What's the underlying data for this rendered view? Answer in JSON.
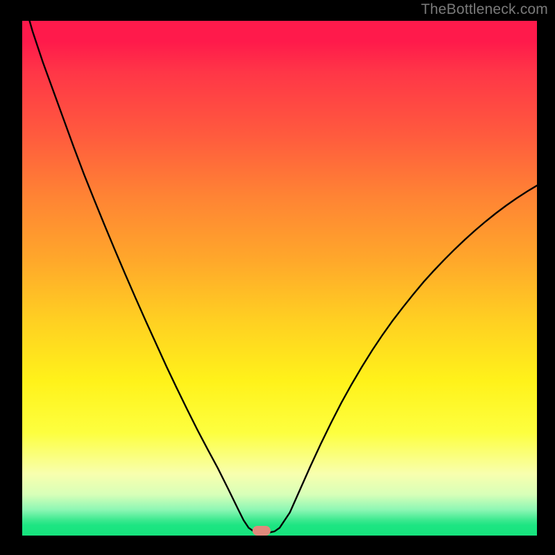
{
  "watermark": "TheBottleneck.com",
  "colors": {
    "frame_bg": "#000000",
    "curve_stroke": "#000000",
    "marker_fill": "#e08a7c",
    "watermark_text": "#7a7a7a",
    "gradient_top": "#ff1a4b",
    "gradient_bottom": "#16e47d"
  },
  "marker": {
    "x_pct": 46.5,
    "y_pct": 99.0
  },
  "chart_data": {
    "type": "line",
    "title": "",
    "xlabel": "",
    "ylabel": "",
    "xlim": [
      0,
      100
    ],
    "ylim": [
      0,
      100
    ],
    "x": [
      0,
      2,
      4,
      6,
      8,
      10,
      12,
      14,
      16,
      18,
      20,
      22,
      24,
      26,
      28,
      30,
      32,
      34,
      36,
      38,
      40,
      42,
      43,
      44,
      45,
      46,
      47,
      48,
      49,
      50,
      52,
      54,
      56,
      58,
      60,
      62,
      64,
      66,
      68,
      70,
      72,
      74,
      76,
      78,
      80,
      82,
      84,
      86,
      88,
      90,
      92,
      94,
      96,
      98,
      100
    ],
    "values": [
      105,
      98,
      92,
      86.5,
      81,
      75.5,
      70.2,
      65.2,
      60.3,
      55.5,
      50.8,
      46.2,
      41.7,
      37.3,
      32.9,
      28.7,
      24.6,
      20.6,
      16.8,
      13.1,
      9.1,
      5.0,
      3.0,
      1.5,
      0.8,
      0.5,
      0.5,
      0.6,
      0.8,
      1.5,
      4.5,
      9.0,
      13.5,
      17.8,
      21.9,
      25.8,
      29.4,
      32.8,
      36.0,
      39.0,
      41.8,
      44.4,
      46.9,
      49.3,
      51.5,
      53.6,
      55.6,
      57.5,
      59.3,
      61.0,
      62.6,
      64.1,
      65.5,
      66.8,
      68.0
    ],
    "annotations": []
  }
}
